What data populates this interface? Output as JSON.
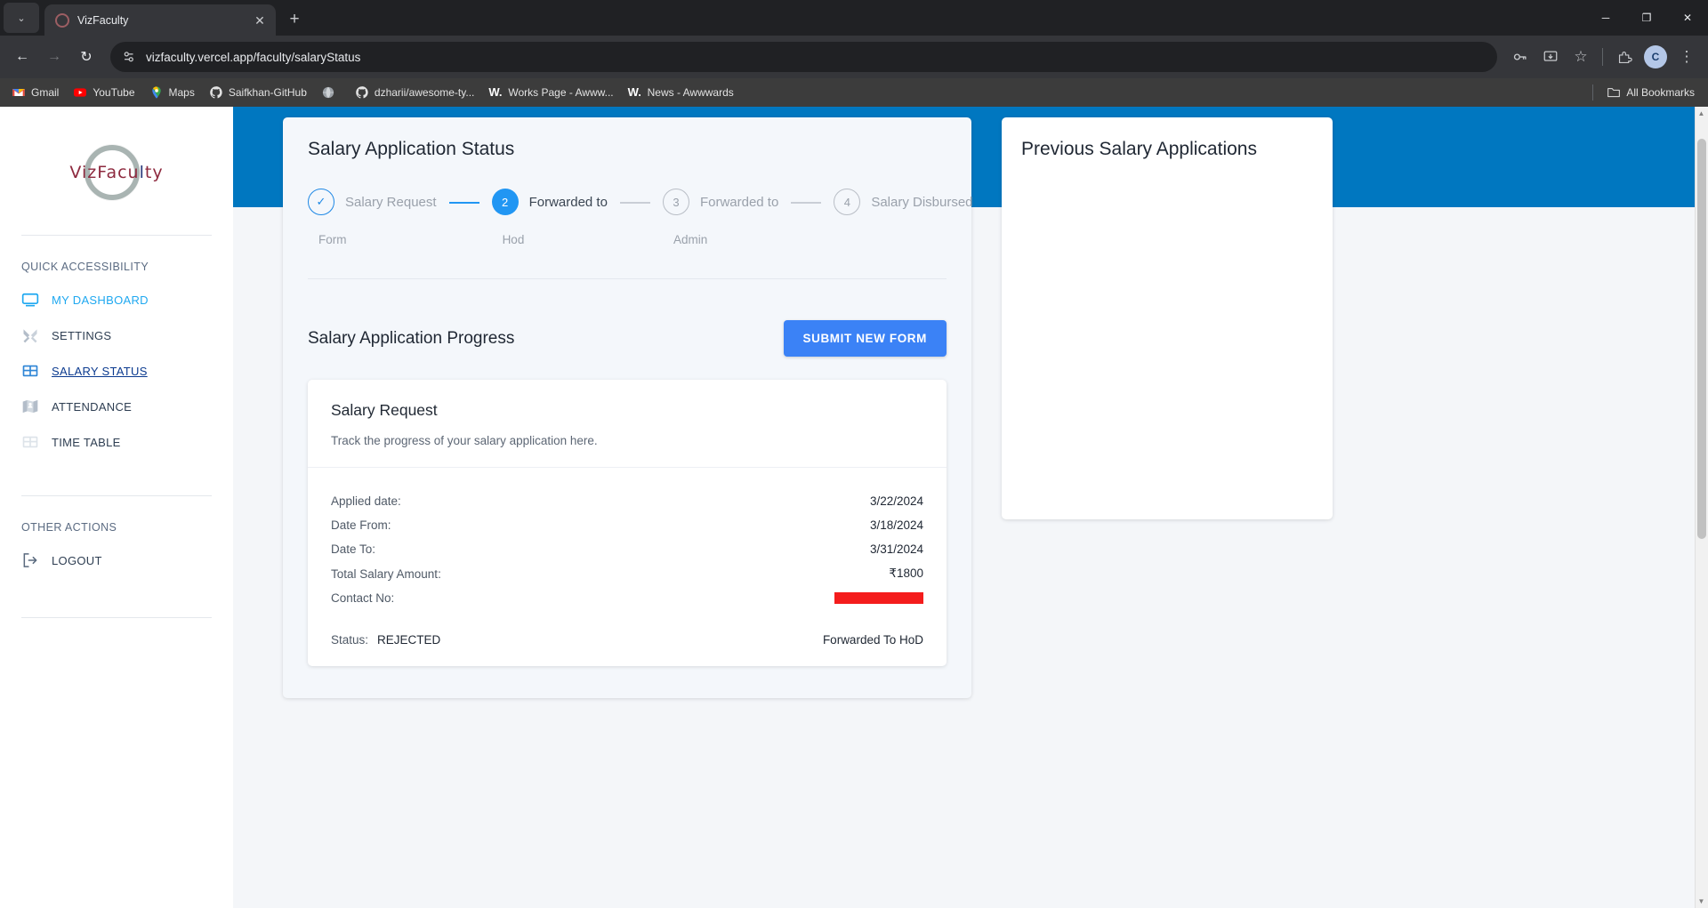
{
  "browser": {
    "tab": {
      "title": "VizFaculty",
      "favicon": "circle-favicon",
      "close_label": "✕"
    },
    "tab_list_label": "⌄",
    "new_tab_label": "+",
    "window": {
      "minimize": "─",
      "maximize": "❐",
      "close": "✕"
    },
    "nav": {
      "back": "←",
      "forward": "→",
      "reload": "↻"
    },
    "omnibox": {
      "url": "vizfaculty.vercel.app/faculty/salaryStatus",
      "site_icon": "site-settings-icon"
    },
    "actions": {
      "passwords": "⚷",
      "install": "⬇",
      "bookmark_star": "☆",
      "extensions": "🧩",
      "profile_initial": "C",
      "menu": "⋮"
    },
    "bookmarks": [
      {
        "label": "Gmail",
        "icon": "gmail-icon"
      },
      {
        "label": "YouTube",
        "icon": "youtube-icon"
      },
      {
        "label": "Maps",
        "icon": "maps-icon"
      },
      {
        "label": "Saifkhan-GitHub",
        "icon": "github-icon"
      },
      {
        "label": "",
        "icon": "globe-icon"
      },
      {
        "label": "dzharii/awesome-ty...",
        "icon": "github-icon"
      },
      {
        "label": "Works Page - Awww...",
        "icon": "w-icon"
      },
      {
        "label": "News - Awwwards",
        "icon": "w-icon"
      }
    ],
    "all_bookmarks": {
      "label": "All Bookmarks",
      "icon": "folder-icon"
    }
  },
  "sidebar": {
    "logo": {
      "part1": "Viz",
      "part2": "Facu",
      "part3": "l",
      "part4": "ty"
    },
    "sections": [
      {
        "title": "QUICK ACCESSIBILITY",
        "items": [
          {
            "label": "MY DASHBOARD",
            "icon": "monitor-icon",
            "state": "dash"
          },
          {
            "label": "SETTINGS",
            "icon": "tools-icon",
            "state": ""
          },
          {
            "label": "SALARY STATUS",
            "icon": "table-icon",
            "state": "active"
          },
          {
            "label": "ATTENDANCE",
            "icon": "attendance-icon",
            "state": ""
          },
          {
            "label": "TIME TABLE",
            "icon": "table-icon",
            "state": ""
          }
        ]
      },
      {
        "title": "OTHER ACTIONS",
        "items": [
          {
            "label": "LOGOUT",
            "icon": "logout-icon",
            "state": ""
          }
        ]
      }
    ]
  },
  "main": {
    "status_card": {
      "title": "Salary Application Status",
      "steps": [
        {
          "badge": "✓",
          "label": "Salary Request",
          "sub": "Form",
          "state": "done"
        },
        {
          "badge": "2",
          "label": "Forwarded to",
          "sub": "Hod",
          "state": "current"
        },
        {
          "badge": "3",
          "label": "Forwarded to",
          "sub": "Admin",
          "state": "todo"
        },
        {
          "badge": "4",
          "label": "Salary Disbursed",
          "sub": "",
          "state": "todo"
        }
      ],
      "progress_title": "Salary Application Progress",
      "submit_button": "SUBMIT NEW FORM",
      "detail": {
        "heading": "Salary Request",
        "subheading": "Track the progress of your salary application here.",
        "rows": [
          {
            "label": "Applied date:",
            "value": "3/22/2024",
            "redacted": false
          },
          {
            "label": "Date From:",
            "value": "3/18/2024",
            "redacted": false
          },
          {
            "label": "Date To:",
            "value": "3/31/2024",
            "redacted": false
          },
          {
            "label": "Total Salary Amount:",
            "value": "₹1800",
            "redacted": false
          },
          {
            "label": "Contact No:",
            "value": "",
            "redacted": true
          }
        ],
        "status_key": "Status:",
        "status_value": "REJECTED",
        "forwarded_text": "Forwarded To HoD"
      }
    },
    "previous_card": {
      "title": "Previous Salary Applications"
    }
  },
  "colors": {
    "brand_blue": "#0077c0",
    "accent_blue": "#2196f3",
    "button_blue": "#3b82f6",
    "redaction_red": "#f41c1c",
    "link_blue": "#1fa8f0"
  }
}
